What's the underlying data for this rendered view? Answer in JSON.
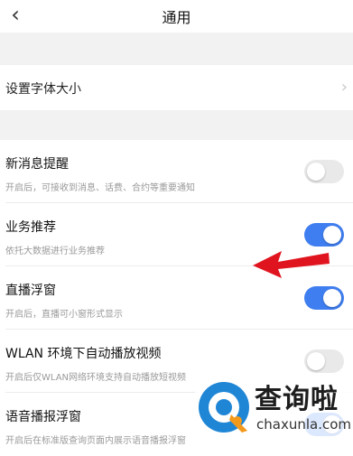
{
  "header": {
    "back_icon": "chevron-left-icon",
    "title": "通用"
  },
  "font_size_row": {
    "label": "设置字体大小",
    "chevron_icon": "chevron-right-icon"
  },
  "settings": [
    {
      "name": "新消息提醒",
      "desc": "开启后，可接收到消息、话费、合约等重要通知",
      "on": false
    },
    {
      "name": "业务推荐",
      "desc": "依托大数据进行业务推荐",
      "on": true
    },
    {
      "name": "直播浮窗",
      "desc": "开启后，直播可小窗形式显示",
      "on": true
    },
    {
      "name": "WLAN 环境下自动播放视频",
      "desc": "开启后仅WLAN网络环境支持自动播放短视频",
      "on": false
    },
    {
      "name": "语音播报浮窗",
      "desc": "开启后在标准版查询页面内展示语音播报浮窗",
      "on": true
    }
  ],
  "colors": {
    "toggle_on": "#3f7ef0",
    "toggle_off": "#e9e9ea",
    "arrow": "#e0141e"
  },
  "watermark": {
    "text": "查询啦",
    "url": "chaxunla.com"
  }
}
